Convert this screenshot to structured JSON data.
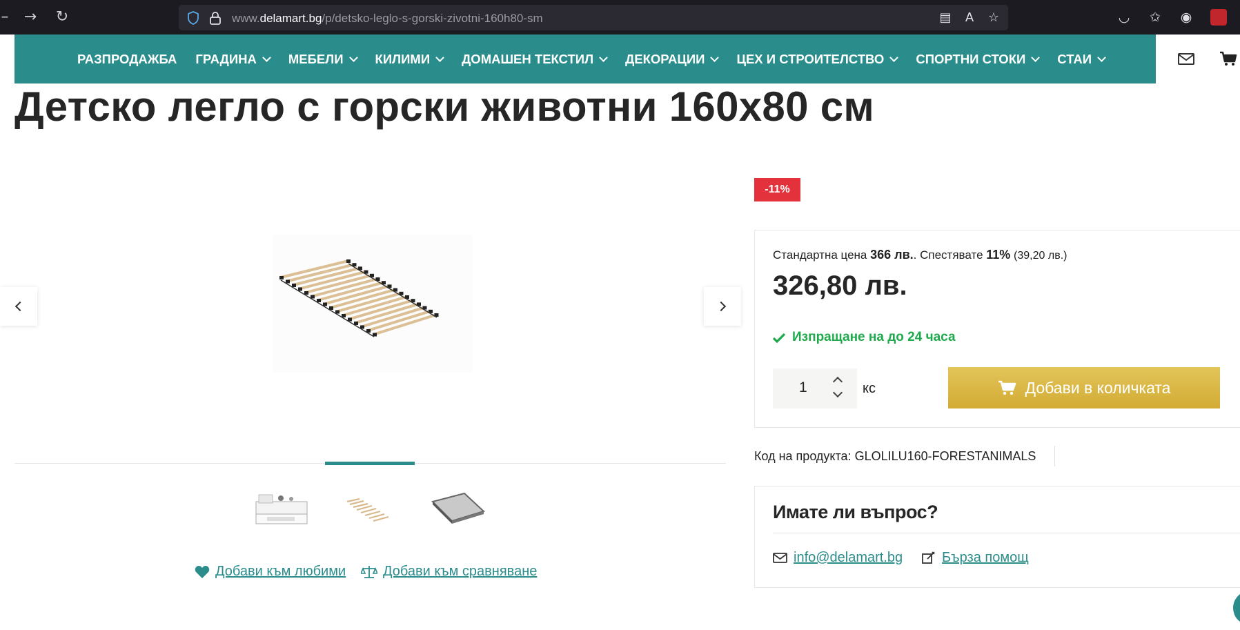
{
  "browser": {
    "back_icon": "back-arrow-icon",
    "forward_icon": "forward-arrow-icon",
    "reload_icon": "reload-icon",
    "url_prefix": "www.",
    "url_domain": "delamart.bg",
    "url_path": "/p/detsko-leglo-s-gorski-zivotni-160h80-sm"
  },
  "nav": {
    "items": [
      {
        "label": "РАЗПРОДАЖБА",
        "dropdown": false
      },
      {
        "label": "ГРАДИНА",
        "dropdown": true
      },
      {
        "label": "МЕБЕЛИ",
        "dropdown": true
      },
      {
        "label": "КИЛИМИ",
        "dropdown": true
      },
      {
        "label": "ДОМАШЕН ТЕКСТИЛ",
        "dropdown": true
      },
      {
        "label": "ДЕКОРАЦИИ",
        "dropdown": true
      },
      {
        "label": "ЦЕХ И СТРОИТЕЛСТВО",
        "dropdown": true
      },
      {
        "label": "СПОРТНИ СТОКИ",
        "dropdown": true
      },
      {
        "label": "СТАИ",
        "dropdown": true
      }
    ],
    "accent": "#2a8d8c"
  },
  "product": {
    "title": "Детско легло с горски животни 160x80 см",
    "discount_badge": "-11%",
    "std_price_label": "Стандартна цена",
    "std_price": "366 лв.",
    "std_price_suffix": ".",
    "save_label": "Спестявате",
    "save_percent": "11%",
    "save_amount": "(39,20 лв.)",
    "price": "326,80 лв.",
    "shipping": "Изпращане на до 24 часа",
    "quantity": "1",
    "unit": "кс",
    "add_to_cart": "Добави в количката",
    "sku_label": "Код на продукта:",
    "sku": "GLOLILU160-FORESTANIMALS"
  },
  "gallery": {
    "add_favorites": "Добави към любими",
    "add_compare": "Добави към сравняване",
    "active_index": 1
  },
  "question": {
    "title": "Имате ли въпрос?",
    "email": "info@delamart.bg",
    "help": "Бърза помощ"
  },
  "colors": {
    "teal": "#2a8d8c",
    "red_badge": "#e4323c",
    "green": "#1daa4b",
    "gold": "#d9b441"
  }
}
